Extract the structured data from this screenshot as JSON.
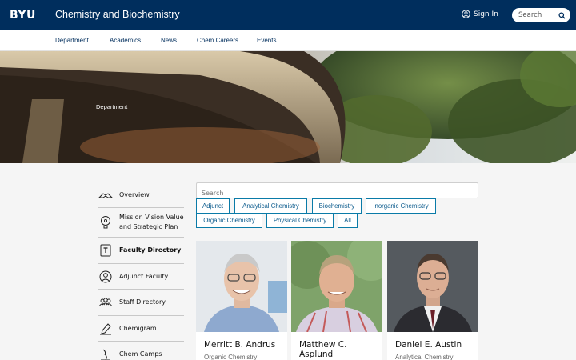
{
  "header": {
    "logo": "BYU",
    "site_title": "Chemistry and Biochemistry",
    "signin_label": "Sign In",
    "search_placeholder": "Search"
  },
  "nav": {
    "items": [
      "Department",
      "Academics",
      "News",
      "Chem Careers",
      "Events"
    ]
  },
  "hero": {
    "label": "Department"
  },
  "sidebar": {
    "items": [
      {
        "label": "Overview",
        "icon": "hands-icon"
      },
      {
        "label": "Mission Vision Value and Strategic Plan",
        "icon": "bulb-head-icon"
      },
      {
        "label": "Faculty Directory",
        "icon": "directory-book-icon"
      },
      {
        "label": "Adjunct Faculty",
        "icon": "person-circle-icon"
      },
      {
        "label": "Staff Directory",
        "icon": "group-icon"
      },
      {
        "label": "Chemigram",
        "icon": "pen-icon"
      },
      {
        "label": "Chem Camps",
        "icon": "bunsen-icon"
      }
    ]
  },
  "directory": {
    "search_placeholder": "Search",
    "filters": [
      "Adjunct",
      "Analytical Chemistry",
      "Biochemistry",
      "Inorganic Chemistry",
      "Organic Chemistry",
      "Physical Chemistry",
      "All"
    ],
    "colors": {
      "chip_border": "#0a7ba8",
      "chip_text": "#0a5a8c"
    },
    "people": [
      {
        "name": "Merritt B. Andrus",
        "department": "Organic Chemistry"
      },
      {
        "name": "Matthew C. Asplund",
        "department": ""
      },
      {
        "name": "Daniel E. Austin",
        "department": "Analytical Chemistry"
      }
    ]
  },
  "colors": {
    "brand": "#002e5d"
  }
}
